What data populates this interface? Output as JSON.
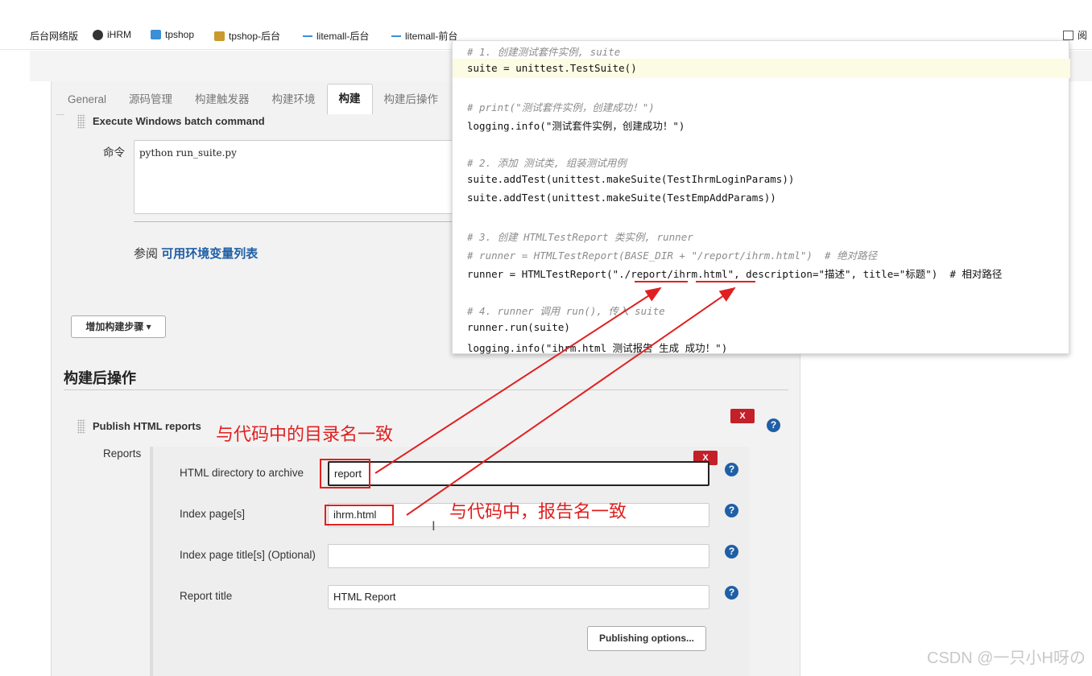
{
  "bookmarks": [
    {
      "label": "后台网络版",
      "icon": "none"
    },
    {
      "label": "iHRM",
      "icon": "globe-icon"
    },
    {
      "label": "tpshop",
      "icon": "folder-icon"
    },
    {
      "label": "tpshop-后台",
      "icon": "briefcase-icon"
    },
    {
      "label": "litemall-后台",
      "icon": "dash-icon"
    },
    {
      "label": "litemall-前台",
      "icon": "dash-icon"
    }
  ],
  "reader_label": "阅",
  "tabs": [
    "General",
    "源码管理",
    "构建触发器",
    "构建环境",
    "构建",
    "构建后操作"
  ],
  "active_tab": "构建",
  "build_step": {
    "title": "Execute Windows batch command",
    "command_label": "命令",
    "command_value": "python run_suite.py",
    "see_also_prefix": "参阅",
    "see_also_link": "可用环境变量列表",
    "add_step_button": "增加构建步骤 ▾"
  },
  "post_build": {
    "heading": "构建后操作",
    "publish_title": "Publish HTML reports",
    "reports_label": "Reports",
    "remove_label": "X",
    "fields": {
      "dir_label": "HTML directory to archive",
      "dir_value": "report",
      "index_label": "Index page[s]",
      "index_value": "ihrm.html",
      "title_opt_label": "Index page title[s] (Optional)",
      "title_opt_value": "",
      "report_title_label": "Report title",
      "report_title_value": "HTML Report"
    },
    "publishing_options_button": "Publishing options..."
  },
  "annotations": {
    "dir_note": "与代码中的目录名一致",
    "report_note": "与代码中，报告名一致"
  },
  "code_lines": [
    {
      "text": "# 1. 创建测试套件实例, suite",
      "type": "comment"
    },
    {
      "text": "suite = unittest.TestSuite()",
      "type": "code"
    },
    {
      "text": "",
      "type": "blank"
    },
    {
      "text": "# print(\"测试套件实例，创建成功！\")",
      "type": "comment"
    },
    {
      "text": "logging.info(\"测试套件实例，创建成功！\")",
      "type": "code"
    },
    {
      "text": "",
      "type": "blank"
    },
    {
      "text": "# 2. 添加 测试类, 组装测试用例",
      "type": "comment"
    },
    {
      "text": "suite.addTest(unittest.makeSuite(TestIhrmLoginParams))",
      "type": "code"
    },
    {
      "text": "suite.addTest(unittest.makeSuite(TestEmpAddParams))",
      "type": "code"
    },
    {
      "text": "",
      "type": "blank"
    },
    {
      "text": "# 3. 创建 HTMLTestReport 类实例, runner",
      "type": "comment"
    },
    {
      "text": "# runner = HTMLTestReport(BASE_DIR + \"/report/ihrm.html\")  # 绝对路径",
      "type": "comment"
    },
    {
      "text": "runner = HTMLTestReport(\"./report/ihrm.html\", description=\"描述\", title=\"标题\")  # 相对路径",
      "type": "code"
    },
    {
      "text": "",
      "type": "blank"
    },
    {
      "text": "# 4. runner 调用 run(), 传入 suite",
      "type": "comment"
    },
    {
      "text": "runner.run(suite)",
      "type": "code"
    },
    {
      "text": "logging.info(\"ihrm.html 测试报告 生成 成功！\")",
      "type": "code"
    }
  ],
  "watermark": "CSDN @一只小H呀の"
}
